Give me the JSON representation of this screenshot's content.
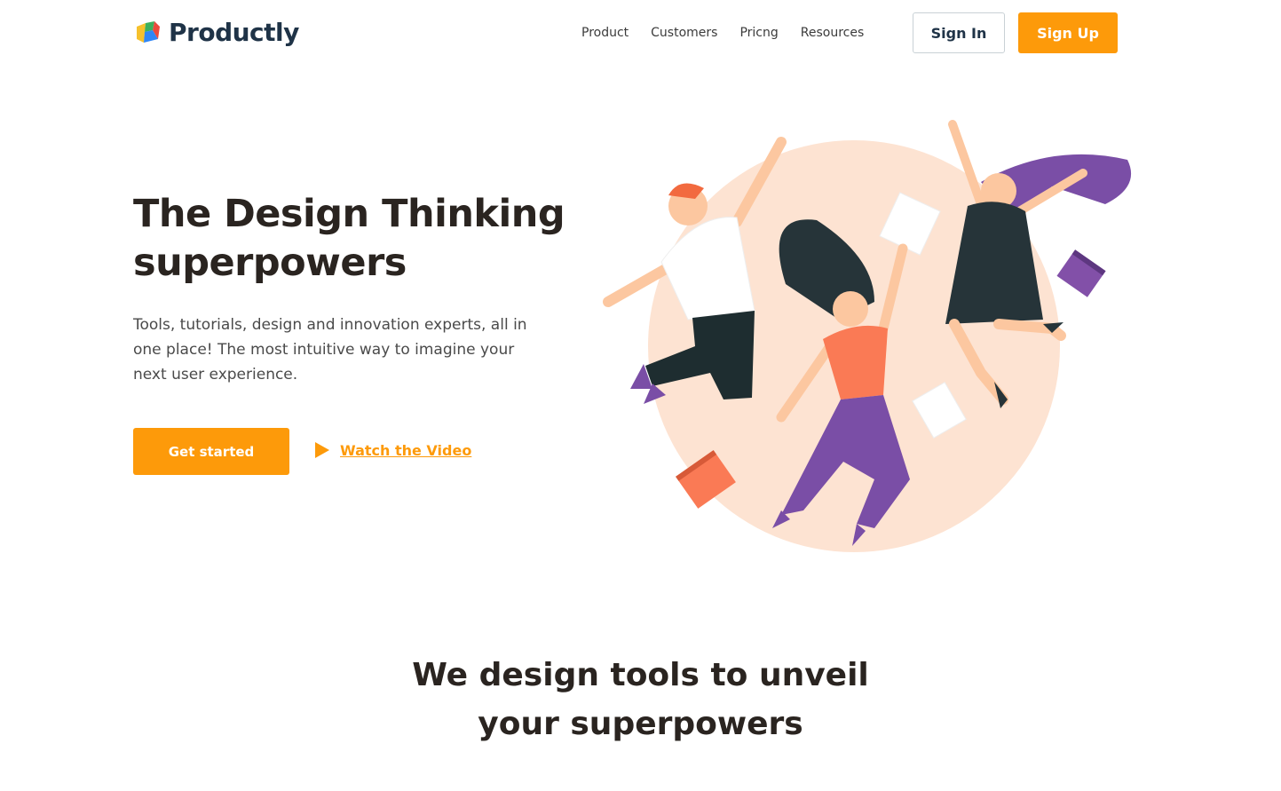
{
  "brand": {
    "name": "Productly",
    "logo_icon": "productly-logo-icon",
    "colors": {
      "accent": "#fd9a0a",
      "navy": "#1f3347",
      "text": "#2a2420",
      "blob": "#fde3d2"
    }
  },
  "nav": {
    "links": [
      "Product",
      "Customers",
      "Pricng",
      "Resources"
    ],
    "sign_in": "Sign In",
    "sign_up": "Sign Up"
  },
  "hero": {
    "title_line1": "The Design Thinking",
    "title_line2": "superpowers",
    "subtitle": "Tools, tutorials, design and innovation experts, all in one place! The most intuitive way to imagine your next user experience.",
    "cta_primary": "Get started",
    "cta_secondary": "Watch the Video",
    "cta_secondary_icon": "play-icon",
    "illustration": "jumping-people-illustration"
  },
  "section": {
    "title_line1": "We design tools to unveil",
    "title_line2": "your superpowers"
  }
}
